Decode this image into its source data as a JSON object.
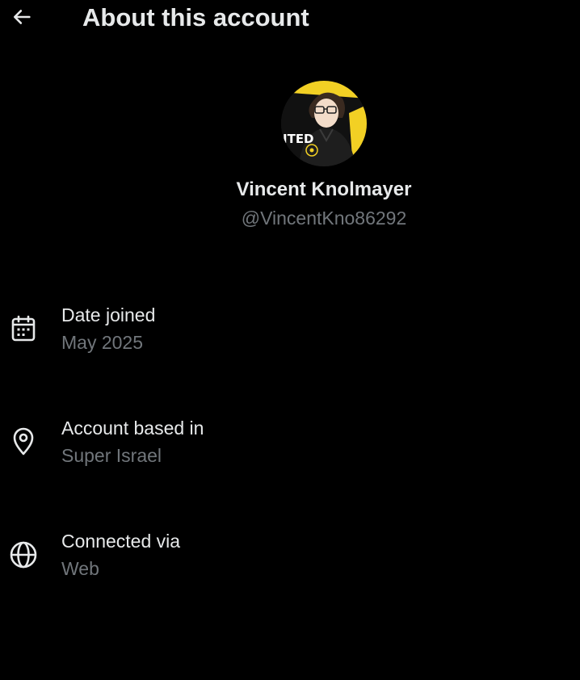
{
  "header": {
    "title": "About this account",
    "back_icon": "arrow-left-icon"
  },
  "profile": {
    "name": "Vincent Knolmayer",
    "handle": "@VincentKno86292",
    "avatar_text": "ITED"
  },
  "details": [
    {
      "icon": "calendar-icon",
      "label": "Date joined",
      "value": "May 2025"
    },
    {
      "icon": "location-pin-icon",
      "label": "Account based in",
      "value": "Super Israel"
    },
    {
      "icon": "globe-icon",
      "label": "Connected via",
      "value": "Web"
    }
  ],
  "colors": {
    "background": "#000000",
    "primary_text": "#e7e9ea",
    "secondary_text": "#71767b",
    "avatar_accent": "#f2d024"
  }
}
